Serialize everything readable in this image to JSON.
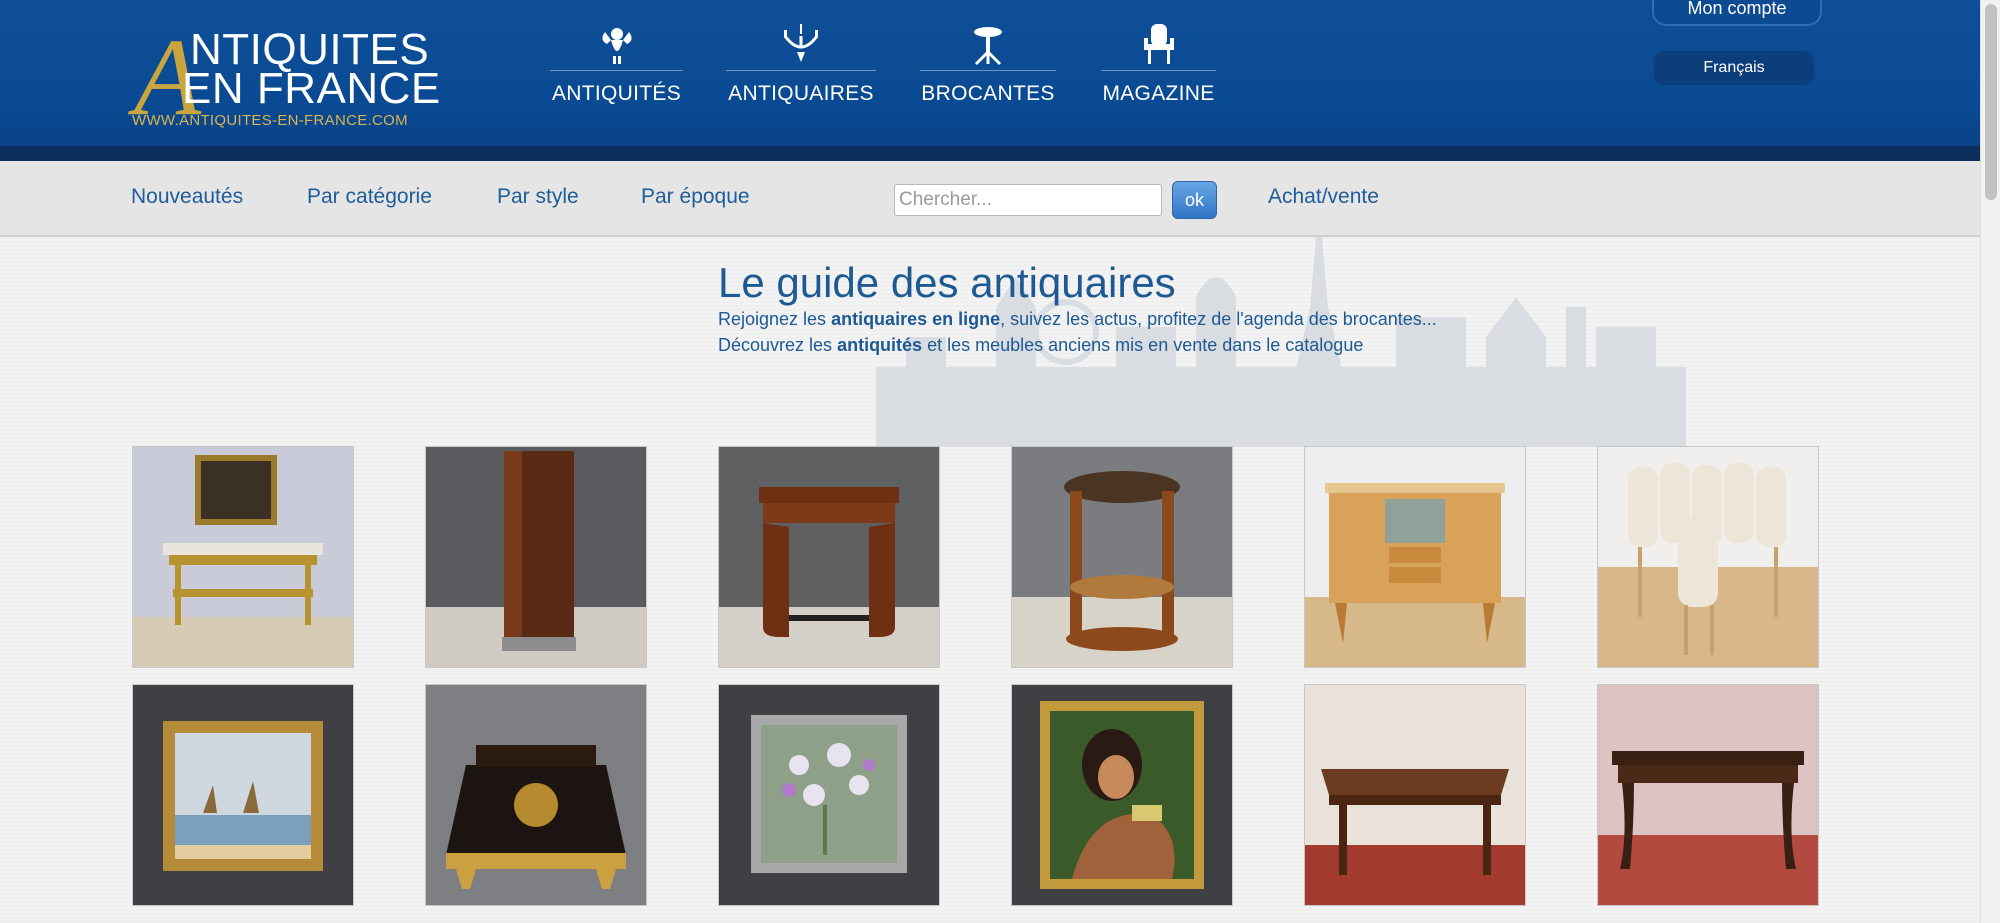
{
  "header": {
    "logo": {
      "line1": "NTIQUITES",
      "line2": "EN FRANCE",
      "url": "WWW.ANTIQUITES-EN-FRANCE.COM",
      "letter": "A"
    },
    "nav": [
      {
        "label": "ANTIQUITÉS",
        "icon": "cherub-icon"
      },
      {
        "label": "ANTIQUAIRES",
        "icon": "chandelier-icon"
      },
      {
        "label": "BROCANTES",
        "icon": "gueridon-table-icon"
      },
      {
        "label": "MAGAZINE",
        "icon": "armchair-icon"
      }
    ],
    "account_label": "Mon compte",
    "language_label": "Français"
  },
  "subnav": {
    "items": [
      "Nouveautés",
      "Par catégorie",
      "Par style",
      "Par époque"
    ],
    "search_placeholder": "Chercher...",
    "search_button": "ok",
    "achat_vente": "Achat/vente"
  },
  "content": {
    "title": "Le guide des antiquaires",
    "intro1_pre": "Rejoignez les ",
    "intro1_bold": "antiquaires en ligne",
    "intro1_post": ", suivez les actus, profitez de l'agenda des brocantes...",
    "intro2_pre": "Découvrez les ",
    "intro2_bold": "antiquités",
    "intro2_post": " et les meubles anciens mis en vente dans le catalogue"
  },
  "colors": {
    "header_blue": "#0a4a93",
    "gold": "#c8a53e",
    "link_blue": "#1e5d9a"
  },
  "products": [
    {
      "subject": "gilt console with painting"
    },
    {
      "subject": "art deco rosewood cabinet"
    },
    {
      "subject": "art deco side table"
    },
    {
      "subject": "round art deco gueridon"
    },
    {
      "subject": "1950s sideboard"
    },
    {
      "subject": "set of upholstered chairs"
    },
    {
      "subject": "seascape painting in gilt frame"
    },
    {
      "subject": "boulle marquetry box"
    },
    {
      "subject": "flower bouquet painting"
    },
    {
      "subject": "portrait painting of woman"
    },
    {
      "subject": "parquetry games table"
    },
    {
      "subject": "louis xv walnut table"
    }
  ]
}
